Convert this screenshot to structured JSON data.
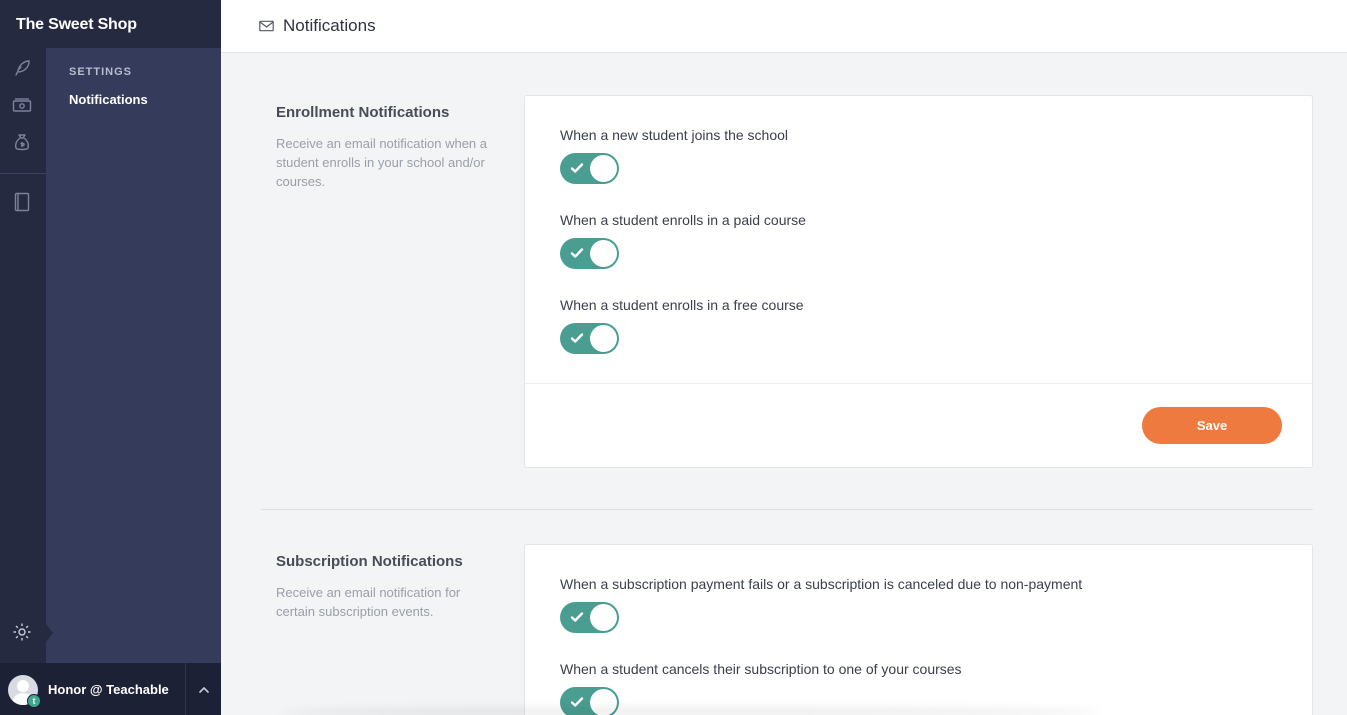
{
  "app": {
    "school_name": "The Sweet Shop"
  },
  "rail": {
    "icons": [
      "feather-icon",
      "money-icon",
      "money-bag-icon",
      "book-icon",
      "gear-icon"
    ]
  },
  "subnav": {
    "heading": "SETTINGS",
    "active_item": "Notifications"
  },
  "user": {
    "name": "Honor @ Teachable",
    "badge": "t"
  },
  "header": {
    "title": "Notifications",
    "icon": "envelope-icon"
  },
  "enrollment": {
    "title": "Enrollment Notifications",
    "description": "Receive an email notification when a student enrolls in your school and/or courses.",
    "options": [
      {
        "label": "When a new student joins the school",
        "enabled": true
      },
      {
        "label": "When a student enrolls in a paid course",
        "enabled": true
      },
      {
        "label": "When a student enrolls in a free course",
        "enabled": true
      }
    ],
    "save_label": "Save"
  },
  "subscription": {
    "title": "Subscription Notifications",
    "description": "Receive an email notification for certain subscription events.",
    "options": [
      {
        "label": "When a subscription payment fails or a subscription is canceled due to non-payment",
        "enabled": true
      },
      {
        "label": "When a student cancels their subscription to one of your courses",
        "enabled": true
      }
    ]
  },
  "colors": {
    "sidebar_dark": "#252a41",
    "sidebar_mid": "#353b5a",
    "toggle_on": "#4a9e91",
    "accent": "#ef7a3f"
  }
}
